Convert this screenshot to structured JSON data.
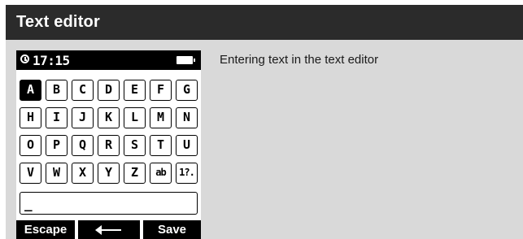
{
  "window": {
    "title": "Text editor"
  },
  "status_bar": {
    "time": "17:15",
    "icons": [
      "clock-icon",
      "battery-icon"
    ]
  },
  "keyboard": {
    "selected_key": "A",
    "rows": [
      [
        "A",
        "B",
        "C",
        "D",
        "E",
        "F",
        "G"
      ],
      [
        "H",
        "I",
        "J",
        "K",
        "L",
        "M",
        "N"
      ],
      [
        "O",
        "P",
        "Q",
        "R",
        "S",
        "T",
        "U"
      ],
      [
        "V",
        "W",
        "X",
        "Y",
        "Z",
        "ab",
        "1?."
      ]
    ]
  },
  "text_field": {
    "value": "_"
  },
  "softkeys": {
    "left": "Escape",
    "middle_icon": "backspace-arrow-icon",
    "right": "Save"
  },
  "description": "Entering text in the text editor",
  "colors": {
    "title_bar": "#2b2b2b",
    "panel_background": "#d9d9d9",
    "screen_background": "#ffffff",
    "screen_foreground": "#000000"
  }
}
